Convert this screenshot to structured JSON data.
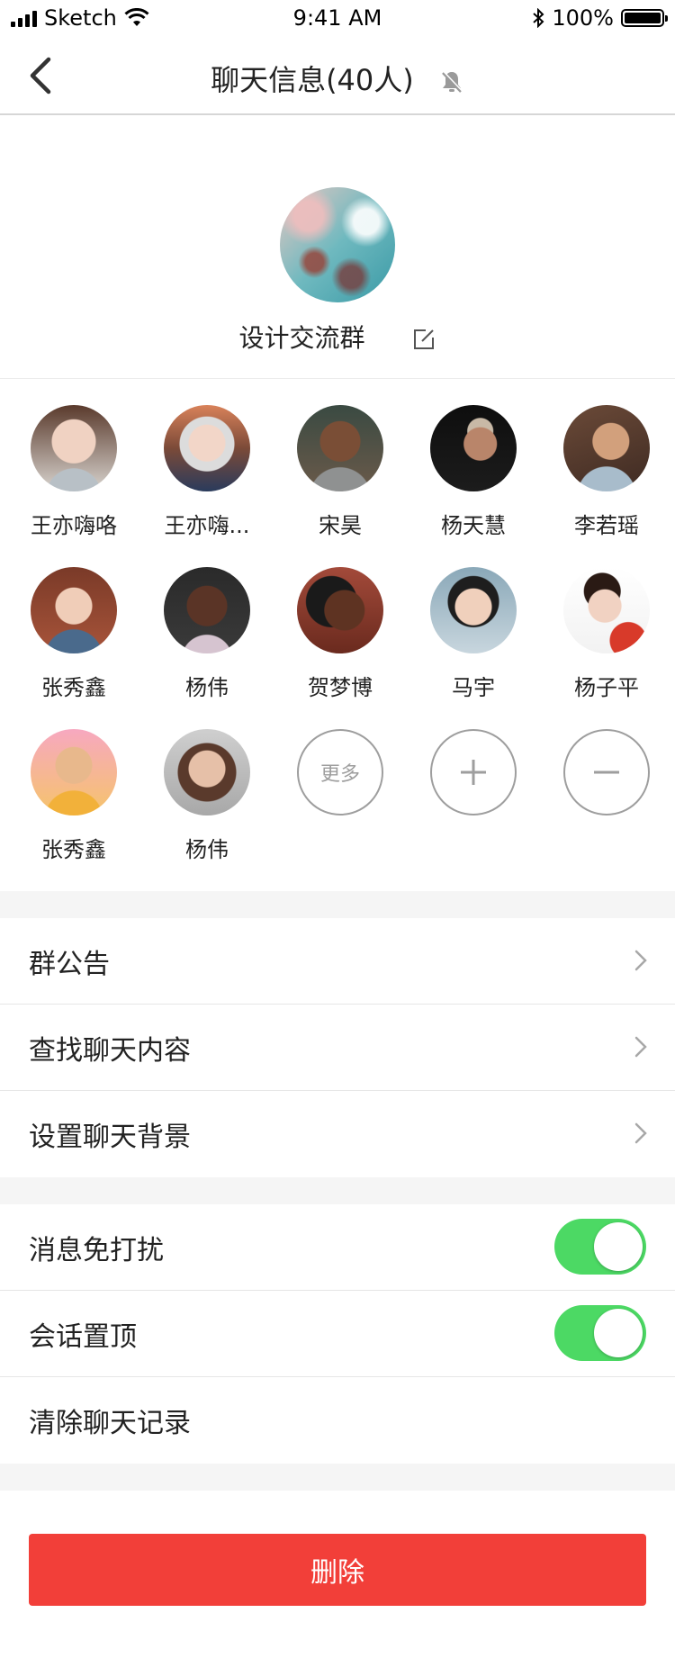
{
  "status_bar": {
    "carrier": "Sketch",
    "time": "9:41 AM",
    "battery": "100%"
  },
  "nav": {
    "title": "聊天信息(40人)",
    "back_icon": "chevron-left-icon",
    "mute_icon": "bell-off-icon"
  },
  "group": {
    "name": "设计交流群",
    "edit_icon": "edit-icon"
  },
  "members": [
    {
      "name": "王亦嗨咯"
    },
    {
      "name": "王亦嗨..."
    },
    {
      "name": "宋昊"
    },
    {
      "name": "杨天慧"
    },
    {
      "name": "李若瑶"
    },
    {
      "name": "张秀鑫"
    },
    {
      "name": "杨伟"
    },
    {
      "name": "贺梦博"
    },
    {
      "name": "马宇"
    },
    {
      "name": "杨子平"
    },
    {
      "name": "张秀鑫"
    },
    {
      "name": "杨伟"
    }
  ],
  "member_actions": {
    "more_label": "更多",
    "add_icon": "plus-icon",
    "remove_icon": "minus-icon"
  },
  "settings": {
    "announcement": "群公告",
    "search_history": "查找聊天内容",
    "set_background": "设置聊天背景",
    "do_not_disturb": "消息免打扰",
    "pin_chat": "会话置顶",
    "clear_history": "清除聊天记录"
  },
  "toggles": {
    "do_not_disturb_on": true,
    "pin_chat_on": true
  },
  "delete_label": "删除",
  "colors": {
    "accent_red": "#f23f39",
    "toggle_green": "#4cd964"
  }
}
